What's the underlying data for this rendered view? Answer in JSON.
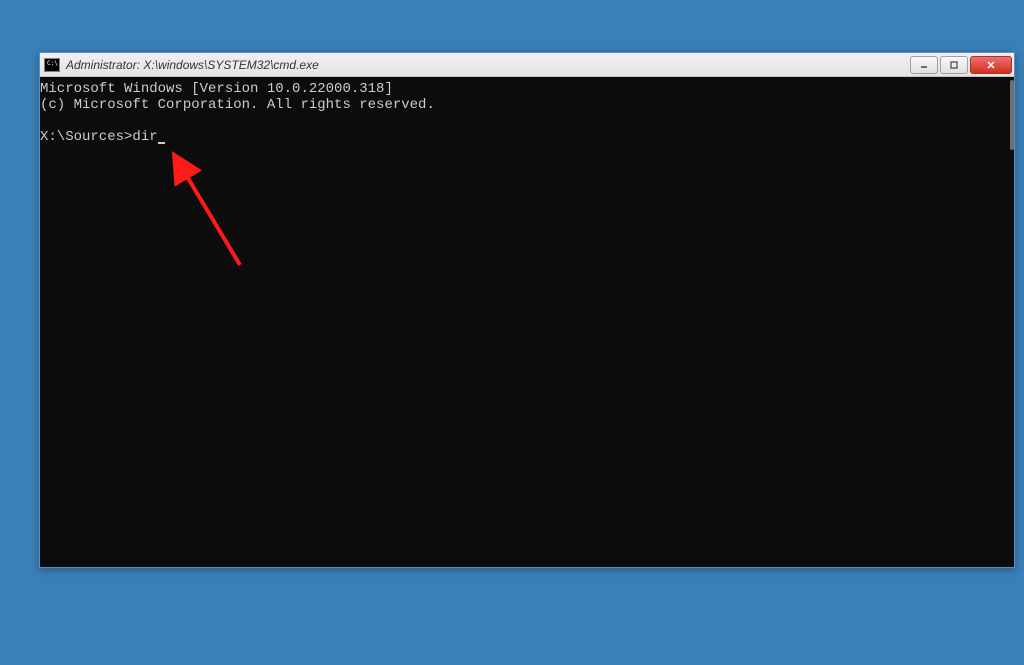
{
  "window": {
    "icon_label": "C:\\",
    "title": "Administrator: X:\\windows\\SYSTEM32\\cmd.exe"
  },
  "terminal": {
    "header_line1": "Microsoft Windows [Version 10.0.22000.318]",
    "header_line2": "(c) Microsoft Corporation. All rights reserved.",
    "prompt": "X:\\Sources>",
    "command": "dir"
  },
  "annotation": {
    "arrow_color": "#ff1a1a"
  }
}
